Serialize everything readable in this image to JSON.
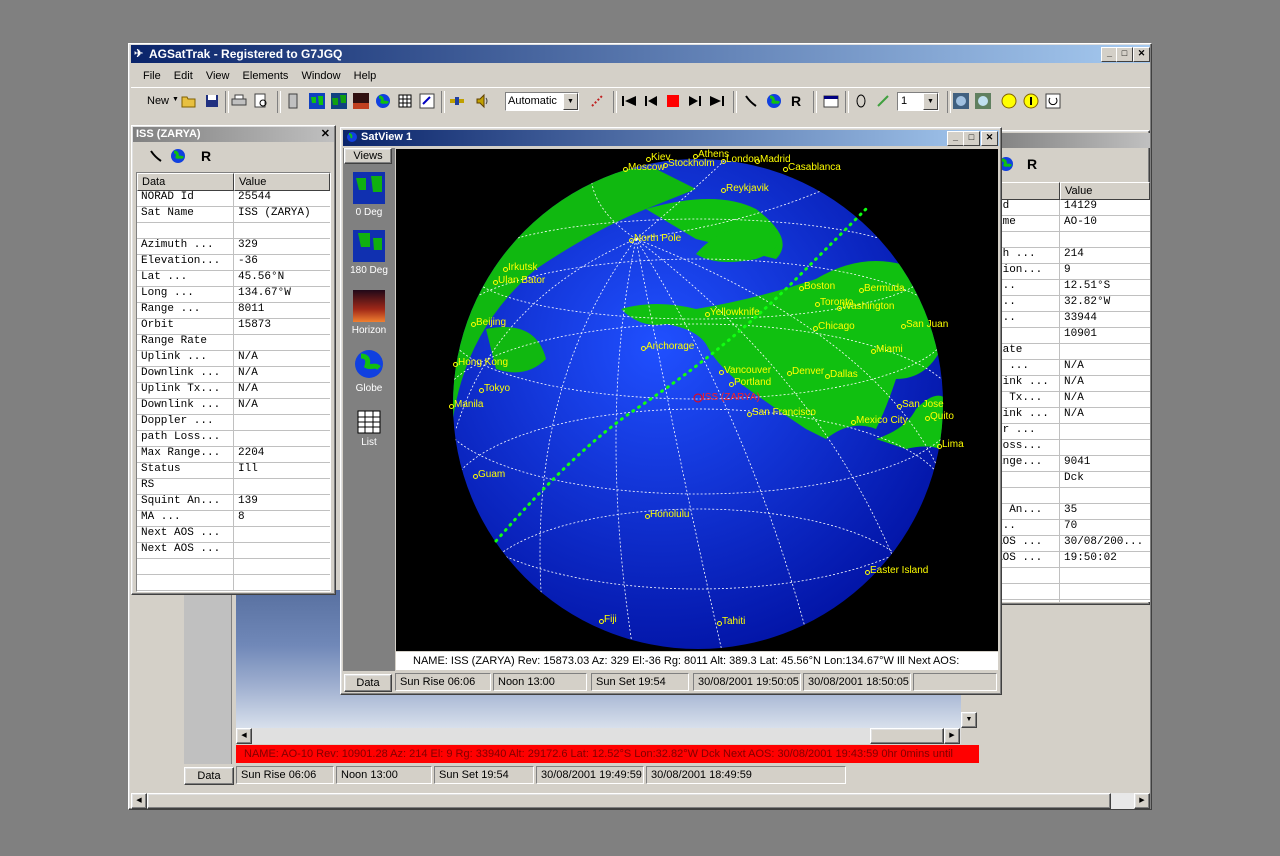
{
  "app": {
    "title": "AGSatTrak - Registered to G7JGQ",
    "menu": [
      "File",
      "Edit",
      "View",
      "Elements",
      "Window",
      "Help"
    ],
    "toolbar": {
      "new_label": "New",
      "mode_select": "Automatic",
      "count_select": "1"
    }
  },
  "left_panel": {
    "title": "ISS (ZARYA)",
    "grid_headers": [
      "Data",
      "Value"
    ],
    "rows": [
      [
        "NORAD Id",
        "25544"
      ],
      [
        "Sat Name",
        "ISS (ZARYA)"
      ],
      [
        "",
        ""
      ],
      [
        "Azimuth  ...",
        "329"
      ],
      [
        "Elevation...",
        "-36"
      ],
      [
        "Lat      ...",
        "45.56°N"
      ],
      [
        "Long     ...",
        "134.67°W"
      ],
      [
        "Range    ...",
        "8011"
      ],
      [
        "Orbit",
        "15873"
      ],
      [
        "Range Rate",
        ""
      ],
      [
        "Uplink   ...",
        "N/A"
      ],
      [
        "Downlink ...",
        "N/A"
      ],
      [
        "Uplink Tx...",
        "N/A"
      ],
      [
        "Downlink ...",
        "N/A"
      ],
      [
        "Doppler  ...",
        ""
      ],
      [
        "path Loss...",
        ""
      ],
      [
        "Max Range...",
        "2204"
      ],
      [
        "Status",
        "Ill"
      ],
      [
        "RS",
        ""
      ],
      [
        "Squint An...",
        "139"
      ],
      [
        "MA       ...",
        "8"
      ],
      [
        "Next AOS ...",
        ""
      ],
      [
        "Next AOS ...",
        ""
      ],
      [
        "",
        ""
      ],
      [
        "",
        ""
      ],
      [
        "",
        ""
      ]
    ]
  },
  "right_panel": {
    "grid_header_value": "Value",
    "rows": [
      [
        " Id",
        "14129"
      ],
      [
        "ame",
        "AO-10"
      ],
      [
        "",
        ""
      ],
      [
        "th  ...",
        "214"
      ],
      [
        "tion...",
        "9"
      ],
      [
        "...",
        "12.51°S"
      ],
      [
        "...",
        "32.82°W"
      ],
      [
        "...",
        "33944"
      ],
      [
        "",
        "10901"
      ],
      [
        " Rate",
        ""
      ],
      [
        "k   ...",
        "N/A"
      ],
      [
        "link ...",
        "N/A"
      ],
      [
        "k Tx...",
        "N/A"
      ],
      [
        "link ...",
        "N/A"
      ],
      [
        "er  ...",
        ""
      ],
      [
        "Loss...",
        ""
      ],
      [
        "ange...",
        "9041"
      ],
      [
        "s",
        "Dck"
      ],
      [
        "",
        ""
      ],
      [
        "t An...",
        "35"
      ],
      [
        "...",
        "70"
      ],
      [
        "AOS ...",
        "30/08/200..."
      ],
      [
        "AOS ...",
        "19:50:02"
      ],
      [
        "",
        ""
      ],
      [
        "",
        ""
      ],
      [
        "",
        ""
      ]
    ]
  },
  "satview": {
    "title": "SatView 1",
    "views_label": "Views",
    "views": [
      "0 Deg",
      "180 Deg",
      "Horizon",
      "Globe",
      "List"
    ],
    "sat_label": "ISS (ZARYA)",
    "info_line": "NAME: ISS (ZARYA)  Rev: 15873.03  Az: 329  El:-36  Rg: 8011  Alt: 389.3  Lat: 45.56°N  Lon:134.67°W  Ill Next AOS:",
    "status": [
      "Data",
      "Sun Rise 06:06",
      "Noon 13:00",
      "Sun Set 19:54",
      "30/08/2001 19:50:05",
      "30/08/2001 18:50:05"
    ],
    "cities": [
      "North Pole",
      "Reykjavik",
      "Madrid",
      "Casablanca",
      "Moscow",
      "Stockholm",
      "London",
      "Kiev",
      "Athens",
      "Irkutsk",
      "Ulan Bator",
      "Beijing",
      "Hong Kong",
      "Tokyo",
      "Manila",
      "Guam",
      "Honolulu",
      "Anchorage",
      "Yellowknife",
      "Vancouver",
      "Portland",
      "San Francisco",
      "Denver",
      "Dallas",
      "Chicago",
      "Toronto",
      "Washington",
      "Boston",
      "Bermuda",
      "Miami",
      "San Juan",
      "Mexico City",
      "San Jose",
      "Quito",
      "Lima",
      "Easter Island",
      "Tahiti",
      "Fiji"
    ]
  },
  "back_window": {
    "info_line": "NAME: AO-10  Rev: 10901.28  Az: 214  El: 9  Rg: 33940  Alt: 29172.6  Lat: 12.52°S  Lon:32.82°W   Dck Next AOS:  30/08/2001 19:43:59 0hr 0mins until",
    "status": [
      "Data",
      "Sun Rise 06:06",
      "Noon 13:00",
      "Sun Set 19:54",
      "30/08/2001 19:49:59",
      "30/08/2001 18:49:59"
    ]
  },
  "colors": {
    "accent_title": "#0a246a",
    "alert_bar": "#ff0000",
    "ocean": "#1030c8",
    "land": "#10c010",
    "label": "#ffff00"
  }
}
